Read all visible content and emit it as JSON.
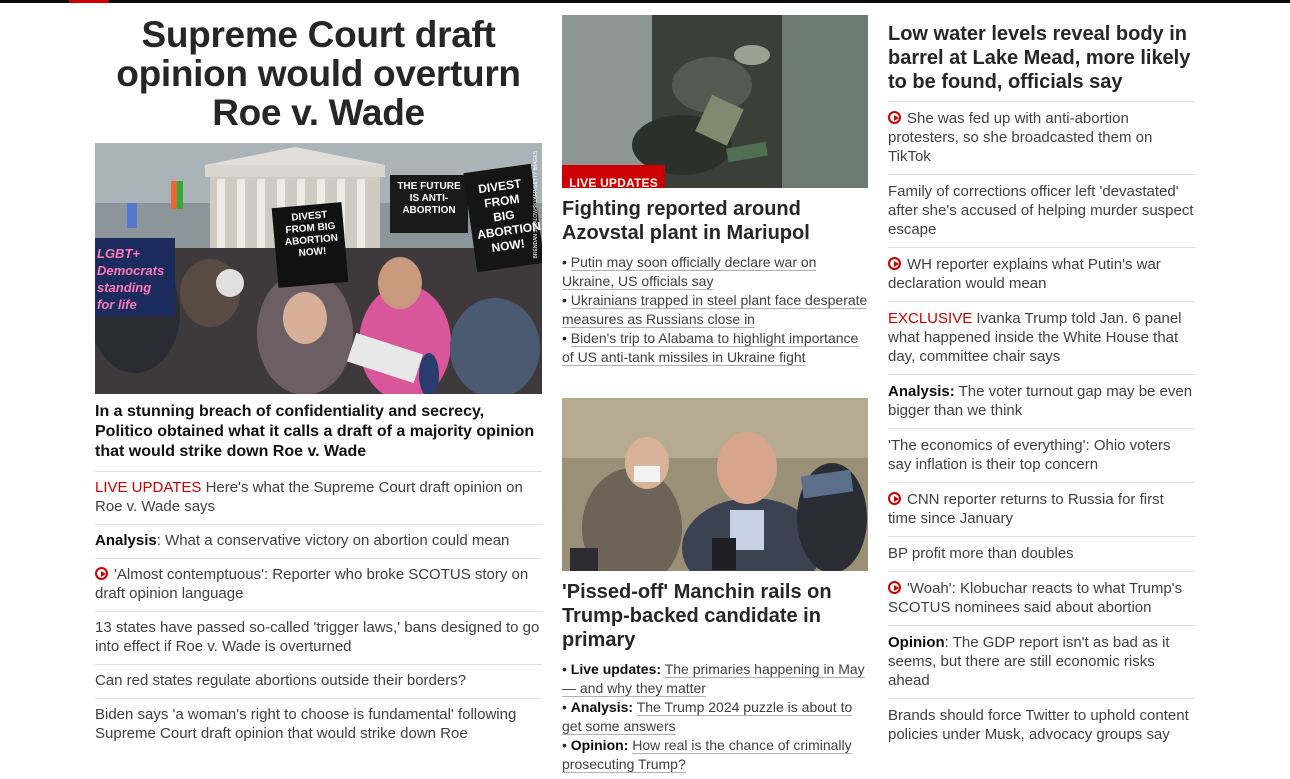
{
  "colors": {
    "accent": "#cc0000",
    "text": "#262626",
    "divider": "#e0e0e0"
  },
  "col1": {
    "headline": "Supreme Court draft opinion would overturn Roe v. Wade",
    "image_credit": "BRENDAN SMIALOWSKI/AFP/GETTY IMAGES",
    "image_signs": {
      "sign1": "DIVEST FROM BIG ABORTION NOW!",
      "sign1_sub": "PAAU",
      "sign2": "THE FUTURE IS ANTI-ABORTION",
      "sign3": "DIVEST FROM BIG ABORTION NOW!",
      "sign3_sub": "PAAU",
      "banner": "LGBT+ Democrats standing for life"
    },
    "caption": "In a stunning breach of confidentiality and secrecy, Politico obtained what it calls a draft of a majority opinion that would strike down Roe v. Wade",
    "items": [
      {
        "prefix": "LIVE UPDATES",
        "text": " Here's what the Supreme Court draft opinion on Roe v. Wade says"
      },
      {
        "prefix": "Analysis",
        "text": ": What a conservative victory on abortion could mean"
      },
      {
        "text": "'Almost contemptuous': Reporter who broke SCOTUS story on draft opinion language",
        "icon": "play-icon"
      },
      {
        "text": "13 states have passed so-called 'trigger laws,' bans designed to go into effect if Roe v. Wade is overturned"
      },
      {
        "text": "Can red states regulate abortions outside their borders?"
      },
      {
        "text": "Biden says 'a woman's right to choose is fundamental' following Supreme Court draft opinion that would strike down Roe"
      }
    ]
  },
  "col2": {
    "badge": "LIVE UPDATES",
    "story1": {
      "headline": "Fighting reported around Azovstal plant in Mariupol",
      "bullets": [
        "Putin may soon officially declare war on Ukraine, US officials say",
        "Ukrainians trapped in steel plant face desperate measures as Russians close in",
        "Biden's trip to Alabama to highlight importance of US anti-tank missiles in Ukraine fight"
      ]
    },
    "story2": {
      "headline": "'Pissed-off' Manchin rails on Trump-backed candidate in primary",
      "bullets": [
        {
          "label": "Live updates:",
          "text": "The primaries happening in May — and why they matter"
        },
        {
          "label": "Analysis:",
          "text": "The Trump 2024 puzzle is about to get some answers"
        },
        {
          "label": "Opinion:",
          "text": "How real is the chance of criminally prosecuting Trump?"
        }
      ]
    }
  },
  "col3": {
    "headline": "Low water levels reveal body in barrel at Lake Mead, more likely to be found, officials say",
    "items": [
      {
        "text": "She was fed up with anti-abortion protesters, so she broadcasted them on TikTok",
        "icon": "play-icon"
      },
      {
        "text": "Family of corrections officer left 'devastated' after she's accused of helping murder suspect escape"
      },
      {
        "text": "WH reporter explains what Putin's war declaration would mean",
        "icon": "play-icon"
      },
      {
        "prefix": "EXCLUSIVE",
        "text": " Ivanka Trump told Jan. 6 panel what happened inside the White House that day, committee chair says"
      },
      {
        "prefix": "Analysis:",
        "text": " The voter turnout gap may be even bigger than we think"
      },
      {
        "text": "'The economics of everything': Ohio voters say inflation is their top concern"
      },
      {
        "text": "CNN reporter returns to Russia for first time since January",
        "icon": "play-icon"
      },
      {
        "text": "BP profit more than doubles"
      },
      {
        "text": "'Woah': Klobuchar reacts to what Trump's SCOTUS nominees said about abortion",
        "icon": "play-icon"
      },
      {
        "prefix": "Opinion",
        "text": ": The GDP report isn't as bad as it seems, but there are still economic risks ahead"
      },
      {
        "text": "Brands should force Twitter to uphold content policies under Musk, advocacy groups say"
      }
    ]
  }
}
